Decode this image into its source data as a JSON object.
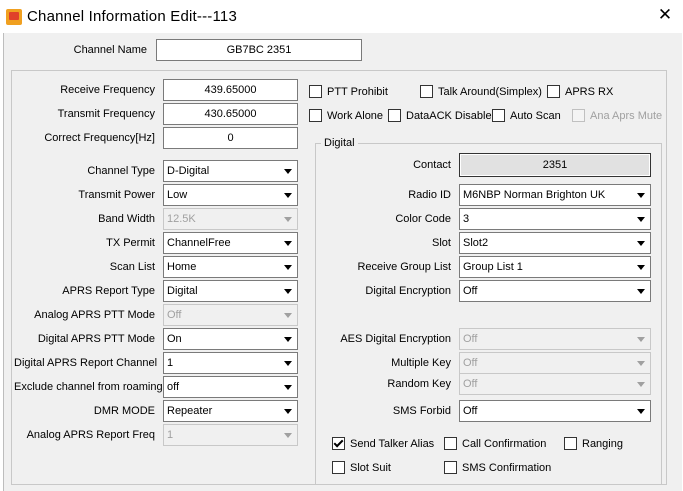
{
  "window": {
    "title": "Channel Information Edit---113",
    "close_glyph": "✕"
  },
  "channel_name": {
    "label": "Channel Name",
    "value": "GB7BC 2351"
  },
  "frequency": {
    "receive": {
      "label": "Receive Frequency",
      "value": "439.65000"
    },
    "transmit": {
      "label": "Transmit Frequency",
      "value": "430.65000"
    },
    "correct": {
      "label": "Correct Frequency[Hz]",
      "value": "0"
    }
  },
  "checks_top": [
    {
      "label": "PTT Prohibit",
      "checked": false,
      "enabled": true
    },
    {
      "label": "Talk Around(Simplex)",
      "checked": false,
      "enabled": true
    },
    {
      "label": "APRS RX",
      "checked": false,
      "enabled": true
    },
    {
      "label": "Work Alone",
      "checked": false,
      "enabled": true
    },
    {
      "label": "DataACK Disable",
      "checked": false,
      "enabled": true
    },
    {
      "label": "Auto Scan",
      "checked": false,
      "enabled": true
    },
    {
      "label": "Ana Aprs Mute",
      "checked": false,
      "enabled": false
    }
  ],
  "left": [
    {
      "label": "Channel Type",
      "value": "D-Digital",
      "enabled": true
    },
    {
      "label": "Transmit Power",
      "value": "Low",
      "enabled": true
    },
    {
      "label": "Band Width",
      "value": "12.5K",
      "enabled": false
    },
    {
      "label": "TX Permit",
      "value": "ChannelFree",
      "enabled": true
    },
    {
      "label": "Scan List",
      "value": "Home",
      "enabled": true
    },
    {
      "label": "APRS Report Type",
      "value": "Digital",
      "enabled": true
    },
    {
      "label": "Analog APRS PTT Mode",
      "value": "Off",
      "enabled": false
    },
    {
      "label": "Digital APRS PTT Mode",
      "value": "On",
      "enabled": true
    },
    {
      "label": "Digital APRS Report Channel",
      "value": "1",
      "enabled": true
    },
    {
      "label": "Exclude channel from roaming",
      "value": "off",
      "enabled": true
    },
    {
      "label": "DMR MODE",
      "value": "Repeater",
      "enabled": true
    },
    {
      "label": "Analog APRS Report Freq",
      "value": "1",
      "enabled": false
    }
  ],
  "digital": {
    "group_title": "Digital",
    "contact": {
      "label": "Contact",
      "value": "2351"
    },
    "fields": [
      {
        "label": "Radio ID",
        "value": "M6NBP Norman Brighton UK",
        "enabled": true
      },
      {
        "label": "Color Code",
        "value": "3",
        "enabled": true
      },
      {
        "label": "Slot",
        "value": "Slot2",
        "enabled": true
      },
      {
        "label": "Receive Group List",
        "value": "Group List 1",
        "enabled": true
      },
      {
        "label": "Digital Encryption",
        "value": "Off",
        "enabled": true
      }
    ],
    "aes": [
      {
        "label": "AES Digital Encryption",
        "value": "Off",
        "enabled": false
      },
      {
        "label": "Multiple Key",
        "value": "Off",
        "enabled": false
      },
      {
        "label": "Random Key",
        "value": "Off",
        "enabled": false
      },
      {
        "label": "SMS Forbid",
        "value": "Off",
        "enabled": true
      }
    ],
    "checks": [
      {
        "label": "Send Talker Alias",
        "checked": true
      },
      {
        "label": "Call Confirmation",
        "checked": false
      },
      {
        "label": "Ranging",
        "checked": false
      },
      {
        "label": "Slot Suit",
        "checked": false
      },
      {
        "label": "SMS Confirmation",
        "checked": false
      }
    ]
  }
}
